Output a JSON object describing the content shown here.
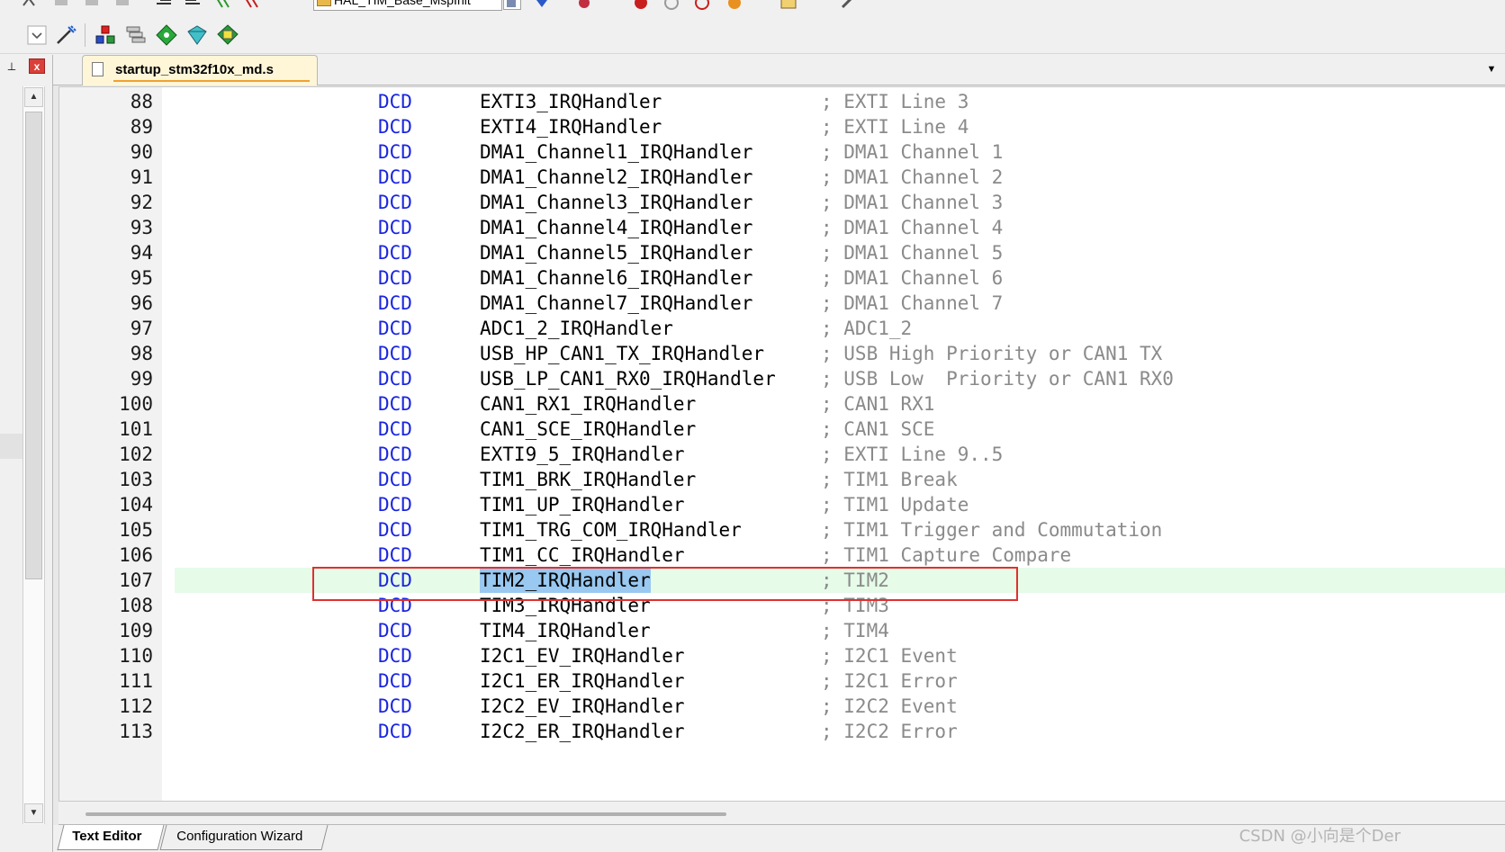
{
  "toolbar_top": {
    "target_name": "HAL_TIM_Base_MspInit"
  },
  "toolbar_second": {
    "icons": [
      "dropdown-icon",
      "options-wand-icon",
      "manage-project-icon",
      "books-icon",
      "green-diamond-icon",
      "pack-installer-icon",
      "rte-icon"
    ]
  },
  "left_panel": {
    "pin_glyph": "⊥",
    "close_glyph": "x"
  },
  "editor": {
    "active_tab": "startup_stm32f10x_md.s",
    "bottom_tabs": [
      "Text Editor",
      "Configuration Wizard"
    ],
    "lines": [
      {
        "num": "88",
        "kw": "DCD",
        "label": "EXTI3_IRQHandler",
        "comment": "; EXTI Line 3"
      },
      {
        "num": "89",
        "kw": "DCD",
        "label": "EXTI4_IRQHandler",
        "comment": "; EXTI Line 4"
      },
      {
        "num": "90",
        "kw": "DCD",
        "label": "DMA1_Channel1_IRQHandler",
        "comment": "; DMA1 Channel 1"
      },
      {
        "num": "91",
        "kw": "DCD",
        "label": "DMA1_Channel2_IRQHandler",
        "comment": "; DMA1 Channel 2"
      },
      {
        "num": "92",
        "kw": "DCD",
        "label": "DMA1_Channel3_IRQHandler",
        "comment": "; DMA1 Channel 3"
      },
      {
        "num": "93",
        "kw": "DCD",
        "label": "DMA1_Channel4_IRQHandler",
        "comment": "; DMA1 Channel 4"
      },
      {
        "num": "94",
        "kw": "DCD",
        "label": "DMA1_Channel5_IRQHandler",
        "comment": "; DMA1 Channel 5"
      },
      {
        "num": "95",
        "kw": "DCD",
        "label": "DMA1_Channel6_IRQHandler",
        "comment": "; DMA1 Channel 6"
      },
      {
        "num": "96",
        "kw": "DCD",
        "label": "DMA1_Channel7_IRQHandler",
        "comment": "; DMA1 Channel 7"
      },
      {
        "num": "97",
        "kw": "DCD",
        "label": "ADC1_2_IRQHandler",
        "comment": "; ADC1_2"
      },
      {
        "num": "98",
        "kw": "DCD",
        "label": "USB_HP_CAN1_TX_IRQHandler",
        "comment": "; USB High Priority or CAN1 TX"
      },
      {
        "num": "99",
        "kw": "DCD",
        "label": "USB_LP_CAN1_RX0_IRQHandler",
        "comment": "; USB Low  Priority or CAN1 RX0"
      },
      {
        "num": "100",
        "kw": "DCD",
        "label": "CAN1_RX1_IRQHandler",
        "comment": "; CAN1 RX1"
      },
      {
        "num": "101",
        "kw": "DCD",
        "label": "CAN1_SCE_IRQHandler",
        "comment": "; CAN1 SCE"
      },
      {
        "num": "102",
        "kw": "DCD",
        "label": "EXTI9_5_IRQHandler",
        "comment": "; EXTI Line 9..5"
      },
      {
        "num": "103",
        "kw": "DCD",
        "label": "TIM1_BRK_IRQHandler",
        "comment": "; TIM1 Break"
      },
      {
        "num": "104",
        "kw": "DCD",
        "label": "TIM1_UP_IRQHandler",
        "comment": "; TIM1 Update"
      },
      {
        "num": "105",
        "kw": "DCD",
        "label": "TIM1_TRG_COM_IRQHandler",
        "comment": "; TIM1 Trigger and Commutation"
      },
      {
        "num": "106",
        "kw": "DCD",
        "label": "TIM1_CC_IRQHandler",
        "comment": "; TIM1 Capture Compare"
      },
      {
        "num": "107",
        "kw": "DCD",
        "label": "TIM2_IRQHandler",
        "comment": "; TIM2",
        "highlight": true,
        "selected": true
      },
      {
        "num": "108",
        "kw": "DCD",
        "label": "TIM3_IRQHandler",
        "comment": "; TIM3"
      },
      {
        "num": "109",
        "kw": "DCD",
        "label": "TIM4_IRQHandler",
        "comment": "; TIM4"
      },
      {
        "num": "110",
        "kw": "DCD",
        "label": "I2C1_EV_IRQHandler",
        "comment": "; I2C1 Event"
      },
      {
        "num": "111",
        "kw": "DCD",
        "label": "I2C1_ER_IRQHandler",
        "comment": "; I2C1 Error"
      },
      {
        "num": "112",
        "kw": "DCD",
        "label": "I2C2_EV_IRQHandler",
        "comment": "; I2C2 Event"
      },
      {
        "num": "113",
        "kw": "DCD",
        "label": "I2C2_ER_IRQHandler",
        "comment": "; I2C2 Error"
      }
    ]
  },
  "colors": {
    "keyword": "#1a25e0",
    "comment": "#8a8a8a",
    "highlight_line": "#e6fbe8",
    "selection": "#99c8f0",
    "annotation_box": "#e03030"
  },
  "watermark": "CSDN @小向是个Der"
}
